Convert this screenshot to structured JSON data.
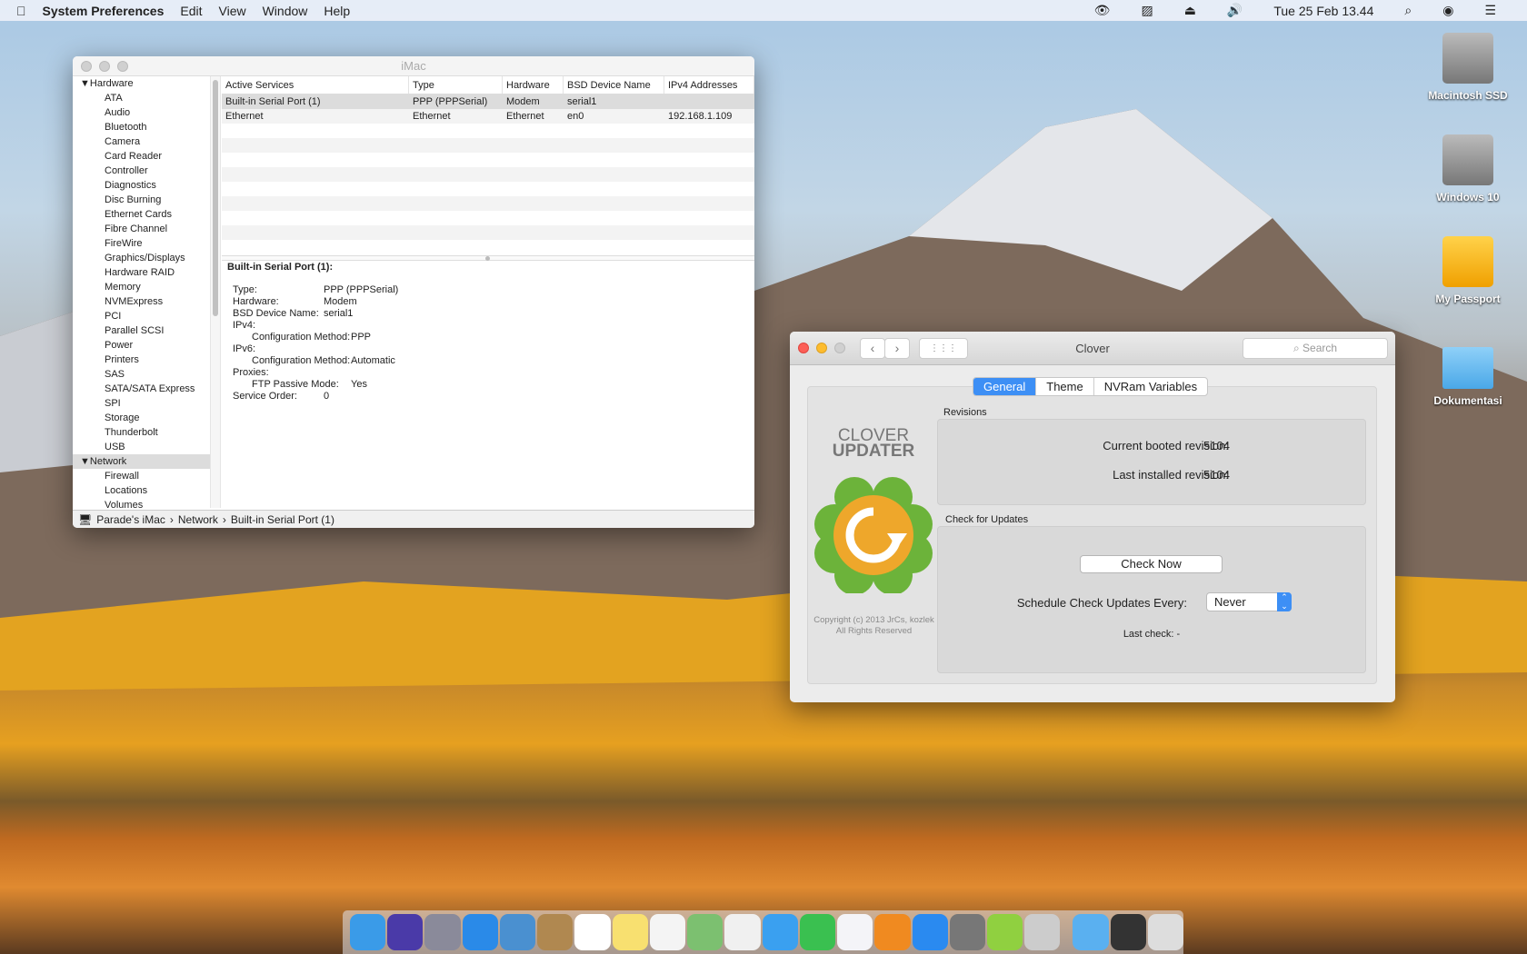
{
  "menubar": {
    "app": "System Preferences",
    "items": [
      "Edit",
      "View",
      "Window",
      "Help"
    ],
    "clock": "Tue 25 Feb  13.44"
  },
  "sysinfo": {
    "title": "iMac",
    "sidebar": [
      "Hardware",
      "ATA",
      "Audio",
      "Bluetooth",
      "Camera",
      "Card Reader",
      "Controller",
      "Diagnostics",
      "Disc Burning",
      "Ethernet Cards",
      "Fibre Channel",
      "FireWire",
      "Graphics/Displays",
      "Hardware RAID",
      "Memory",
      "NVMExpress",
      "PCI",
      "Parallel SCSI",
      "Power",
      "Printers",
      "SAS",
      "SATA/SATA Express",
      "SPI",
      "Storage",
      "Thunderbolt",
      "USB",
      "Network",
      "Firewall",
      "Locations",
      "Volumes"
    ],
    "columns": [
      "Active Services",
      "Type",
      "Hardware",
      "BSD Device Name",
      "IPv4 Addresses"
    ],
    "rows": [
      [
        "Built-in Serial Port (1)",
        "PPP (PPPSerial)",
        "Modem",
        "serial1",
        ""
      ],
      [
        "Ethernet",
        "Ethernet",
        "Ethernet",
        "en0",
        "192.168.1.109"
      ]
    ],
    "detail_title": "Built-in Serial Port (1):",
    "details": [
      [
        "Type:",
        "PPP (PPPSerial)",
        0
      ],
      [
        "Hardware:",
        "Modem",
        0
      ],
      [
        "BSD Device Name:",
        "serial1",
        0
      ],
      [
        "IPv4:",
        "",
        0
      ],
      [
        "Configuration Method:",
        "PPP",
        1
      ],
      [
        "IPv6:",
        "",
        0
      ],
      [
        "Configuration Method:",
        "Automatic",
        1
      ],
      [
        "Proxies:",
        "",
        0
      ],
      [
        "FTP Passive Mode:",
        "Yes",
        1
      ],
      [
        "Service Order:",
        "0",
        0
      ]
    ],
    "path": [
      "Parade's iMac",
      "Network",
      "Built-in Serial Port (1)"
    ]
  },
  "clover": {
    "title": "Clover",
    "search_placeholder": "Search",
    "tabs": [
      "General",
      "Theme",
      "NVRam Variables"
    ],
    "logo_line1": "CLOVER",
    "logo_line2": "UPDATER",
    "revisions_label": "Revisions",
    "current_label": "Current booted revision:",
    "current_value": "5104",
    "installed_label": "Last installed revision:",
    "installed_value": "5104",
    "updates_label": "Check for Updates",
    "check_now": "Check Now",
    "schedule_label": "Schedule Check Updates Every:",
    "schedule_value": "Never",
    "last_check": "Last check: -",
    "copyright1": "Copyright (c) 2013 JrCs, kozlek",
    "copyright2": "All Rights Reserved"
  },
  "desktop": [
    "Macintosh SSD",
    "Windows 10",
    "My Passport",
    "Dokumentasi"
  ],
  "dock": [
    "finder",
    "siri",
    "launchpad",
    "safari",
    "mail",
    "contacts",
    "calendar",
    "notes",
    "reminders",
    "maps",
    "photos",
    "messages",
    "facetime",
    "itunes",
    "ibooks",
    "app-store",
    "system-preferences",
    "clover",
    "utility",
    "downloads",
    "terminal",
    "trash"
  ]
}
